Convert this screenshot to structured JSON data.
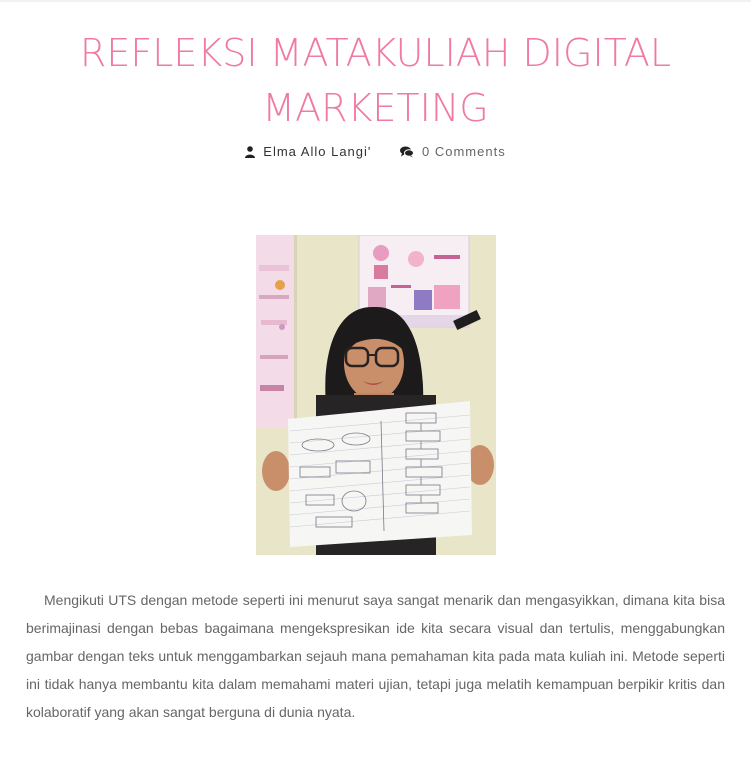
{
  "post": {
    "title_line1": "REFLEKSI MATAKULIAH DIGITAL",
    "title_line2": "MARKETING",
    "author": "Elma Allo Langi'",
    "comments": "0 Comments",
    "body": "Mengikuti UTS dengan metode seperti ini menurut saya sangat menarik dan mengasyikkan, dimana kita bisa berimajinasi dengan bebas bagaimana mengekspresikan ide kita secara visual dan tertulis, menggabungkan gambar dengan teks untuk menggambarkan sejauh mana pemahaman kita pada mata kuliah ini. Metode seperti ini tidak hanya membantu kita dalam memahami materi ujian, tetapi juga melatih kemampuan berpikir kritis dan kolaboratif yang akan sangat berguna di dunia nyata."
  },
  "icons": {
    "author": "user-icon",
    "comments": "comments-icon"
  },
  "colors": {
    "title": "#f07aa0",
    "body_text": "#666666",
    "meta_text": "#333333"
  }
}
